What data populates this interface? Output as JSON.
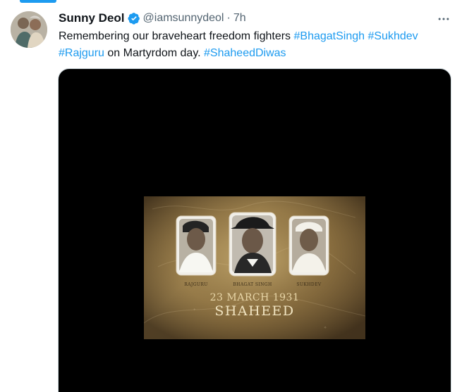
{
  "tweet": {
    "author_name": "Sunny Deol",
    "author_handle": "@iamsunnydeol",
    "separator": "·",
    "timestamp": "7h",
    "text_prefix": "Remembering our braveheart freedom fighters ",
    "hashtags_line1": [
      "#BhagatSingh",
      "#Sukhdev"
    ],
    "hashtag_line2_start": "#Rajguru",
    "text_middle": " on Martyrdom day. ",
    "hashtag_final": "#ShaheedDiwas",
    "more_icon": "more-horizontal-icon",
    "verified_icon": "verified-badge-icon"
  },
  "media": {
    "portrait_labels": [
      "RAJGURU",
      "BHAGAT SINGH",
      "SUKHDEV"
    ],
    "date": "23 MARCH 1931",
    "title": "SHAHEED"
  },
  "colors": {
    "accent": "#1d9bf0",
    "text_primary": "#0f1419",
    "text_secondary": "#536471",
    "media_background": "#000000"
  }
}
